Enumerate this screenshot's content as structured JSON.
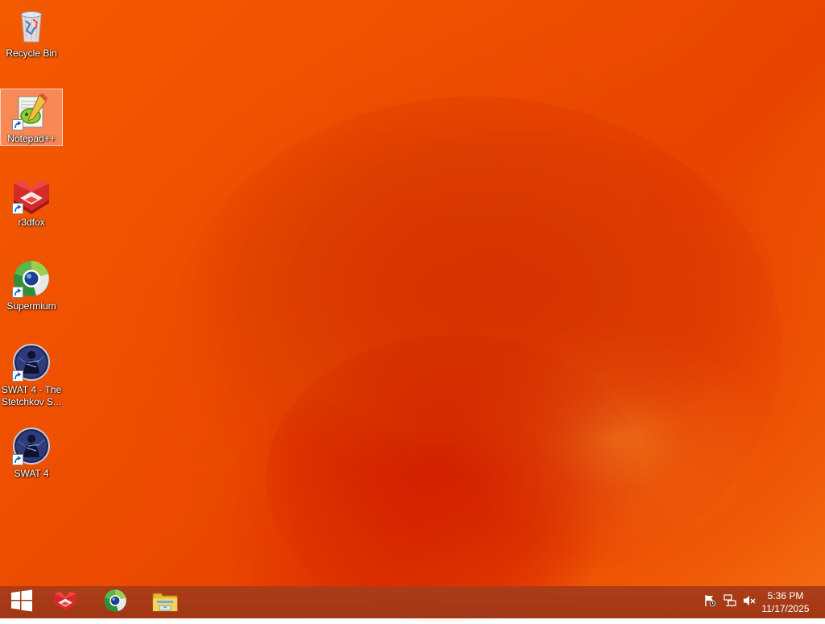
{
  "desktop": {
    "icons": [
      {
        "label": "Recycle Bin",
        "icon": "recycle-bin-icon",
        "shortcut": false
      },
      {
        "label": "Notepad++",
        "icon": "notepadpp-icon",
        "shortcut": true,
        "selected": true
      },
      {
        "label": "r3dfox",
        "icon": "r3dfox-icon",
        "shortcut": true
      },
      {
        "label": "Supermium",
        "icon": "supermium-icon",
        "shortcut": true
      },
      {
        "label": "SWAT 4 - The Stetchkov S...",
        "icon": "swat4-icon",
        "shortcut": true
      },
      {
        "label": "SWAT 4",
        "icon": "swat4-icon",
        "shortcut": true
      }
    ]
  },
  "taskbar": {
    "start_icon": "windows-logo-icon",
    "pinned": [
      {
        "icon": "r3dfox-icon"
      },
      {
        "icon": "supermium-icon"
      },
      {
        "icon": "file-explorer-icon"
      }
    ],
    "tray": [
      {
        "icon": "action-center-flag-icon"
      },
      {
        "icon": "network-icon"
      },
      {
        "icon": "volume-muted-icon"
      }
    ],
    "clock": {
      "time": "5:36 PM",
      "date": "11/17/2025"
    }
  },
  "colors": {
    "wallpaper_primary": "#ee4f00",
    "taskbar": "#a63c19"
  }
}
